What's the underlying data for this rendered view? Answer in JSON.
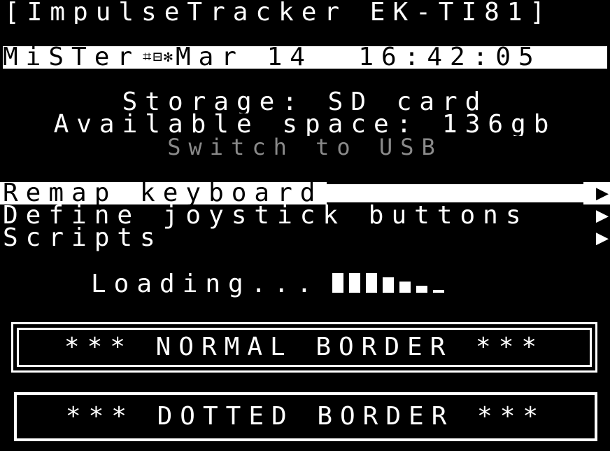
{
  "app_title": "[ImpulseTracker_EK-TI81]",
  "status_bar": {
    "system": "MiSTer",
    "icons": [
      "network-icon",
      "usb-icon",
      "bluetooth-icon"
    ],
    "date": "Mar 14",
    "time": "16:42:05"
  },
  "storage": {
    "storage_line": "Storage: SD card",
    "space_line": "Available space: 136gb",
    "switch_label": "Switch to USB"
  },
  "menu": {
    "items": [
      {
        "label": "Remap keyboard",
        "selected": true
      },
      {
        "label": "Define joystick buttons",
        "selected": false
      },
      {
        "label": "Scripts",
        "selected": false
      }
    ],
    "arrow": "▶"
  },
  "loading": {
    "text": "Loading...",
    "blocks": 7
  },
  "borders": {
    "normal_label": "*** NORMAL BORDER ***",
    "dotted_label": "*** DOTTED BORDER ***"
  },
  "colors": {
    "background": "#000000",
    "foreground": "#ffffff",
    "disabled": "#8a8a8a"
  }
}
